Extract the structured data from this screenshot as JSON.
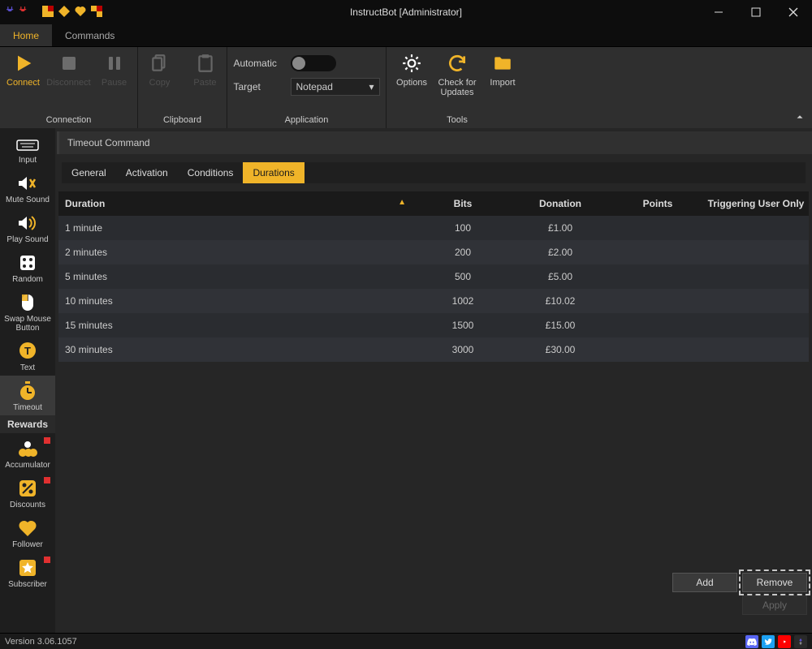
{
  "window": {
    "title": "InstructBot [Administrator]"
  },
  "menubar": {
    "items": [
      "Home",
      "Commands"
    ],
    "active": 0
  },
  "ribbon": {
    "groups": {
      "connection": {
        "label": "Connection",
        "connect": "Connect",
        "disconnect": "Disconnect",
        "pause": "Pause"
      },
      "clipboard": {
        "label": "Clipboard",
        "copy": "Copy",
        "paste": "Paste"
      },
      "application": {
        "label": "Application",
        "automatic": "Automatic",
        "target": "Target",
        "target_value": "Notepad"
      },
      "tools": {
        "label": "Tools",
        "options": "Options",
        "check_updates": "Check for Updates",
        "import": "Import"
      }
    }
  },
  "sidebar": {
    "top_items": [
      {
        "id": "input",
        "label": "Input"
      },
      {
        "id": "mute-sound",
        "label": "Mute Sound"
      },
      {
        "id": "play-sound",
        "label": "Play Sound"
      },
      {
        "id": "random",
        "label": "Random"
      },
      {
        "id": "swap-mouse",
        "label": "Swap Mouse Button"
      },
      {
        "id": "text",
        "label": "Text"
      },
      {
        "id": "timeout",
        "label": "Timeout"
      }
    ],
    "section": "Rewards",
    "bottom_items": [
      {
        "id": "accumulator",
        "label": "Accumulator",
        "flag": true
      },
      {
        "id": "discounts",
        "label": "Discounts",
        "flag": true
      },
      {
        "id": "follower",
        "label": "Follower"
      },
      {
        "id": "subscriber",
        "label": "Subscriber",
        "flag": true
      }
    ],
    "active": "timeout"
  },
  "content": {
    "header": "Timeout Command",
    "tabs": [
      "General",
      "Activation",
      "Conditions",
      "Durations"
    ],
    "active_tab": 3,
    "columns": {
      "duration": "Duration",
      "bits": "Bits",
      "donation": "Donation",
      "points": "Points",
      "triggering": "Triggering User Only"
    },
    "rows": [
      {
        "duration": "1 minute",
        "bits": "100",
        "donation": "£1.00",
        "points": "",
        "triggering": ""
      },
      {
        "duration": "2 minutes",
        "bits": "200",
        "donation": "£2.00",
        "points": "",
        "triggering": ""
      },
      {
        "duration": "5 minutes",
        "bits": "500",
        "donation": "£5.00",
        "points": "",
        "triggering": ""
      },
      {
        "duration": "10 minutes",
        "bits": "1002",
        "donation": "£10.02",
        "points": "",
        "triggering": ""
      },
      {
        "duration": "15 minutes",
        "bits": "1500",
        "donation": "£15.00",
        "points": "",
        "triggering": ""
      },
      {
        "duration": "30 minutes",
        "bits": "3000",
        "donation": "£30.00",
        "points": "",
        "triggering": ""
      }
    ],
    "buttons": {
      "add": "Add",
      "remove": "Remove",
      "apply": "Apply"
    }
  },
  "statusbar": {
    "version": "Version 3.06.1057"
  },
  "colors": {
    "accent": "#f0b429"
  }
}
